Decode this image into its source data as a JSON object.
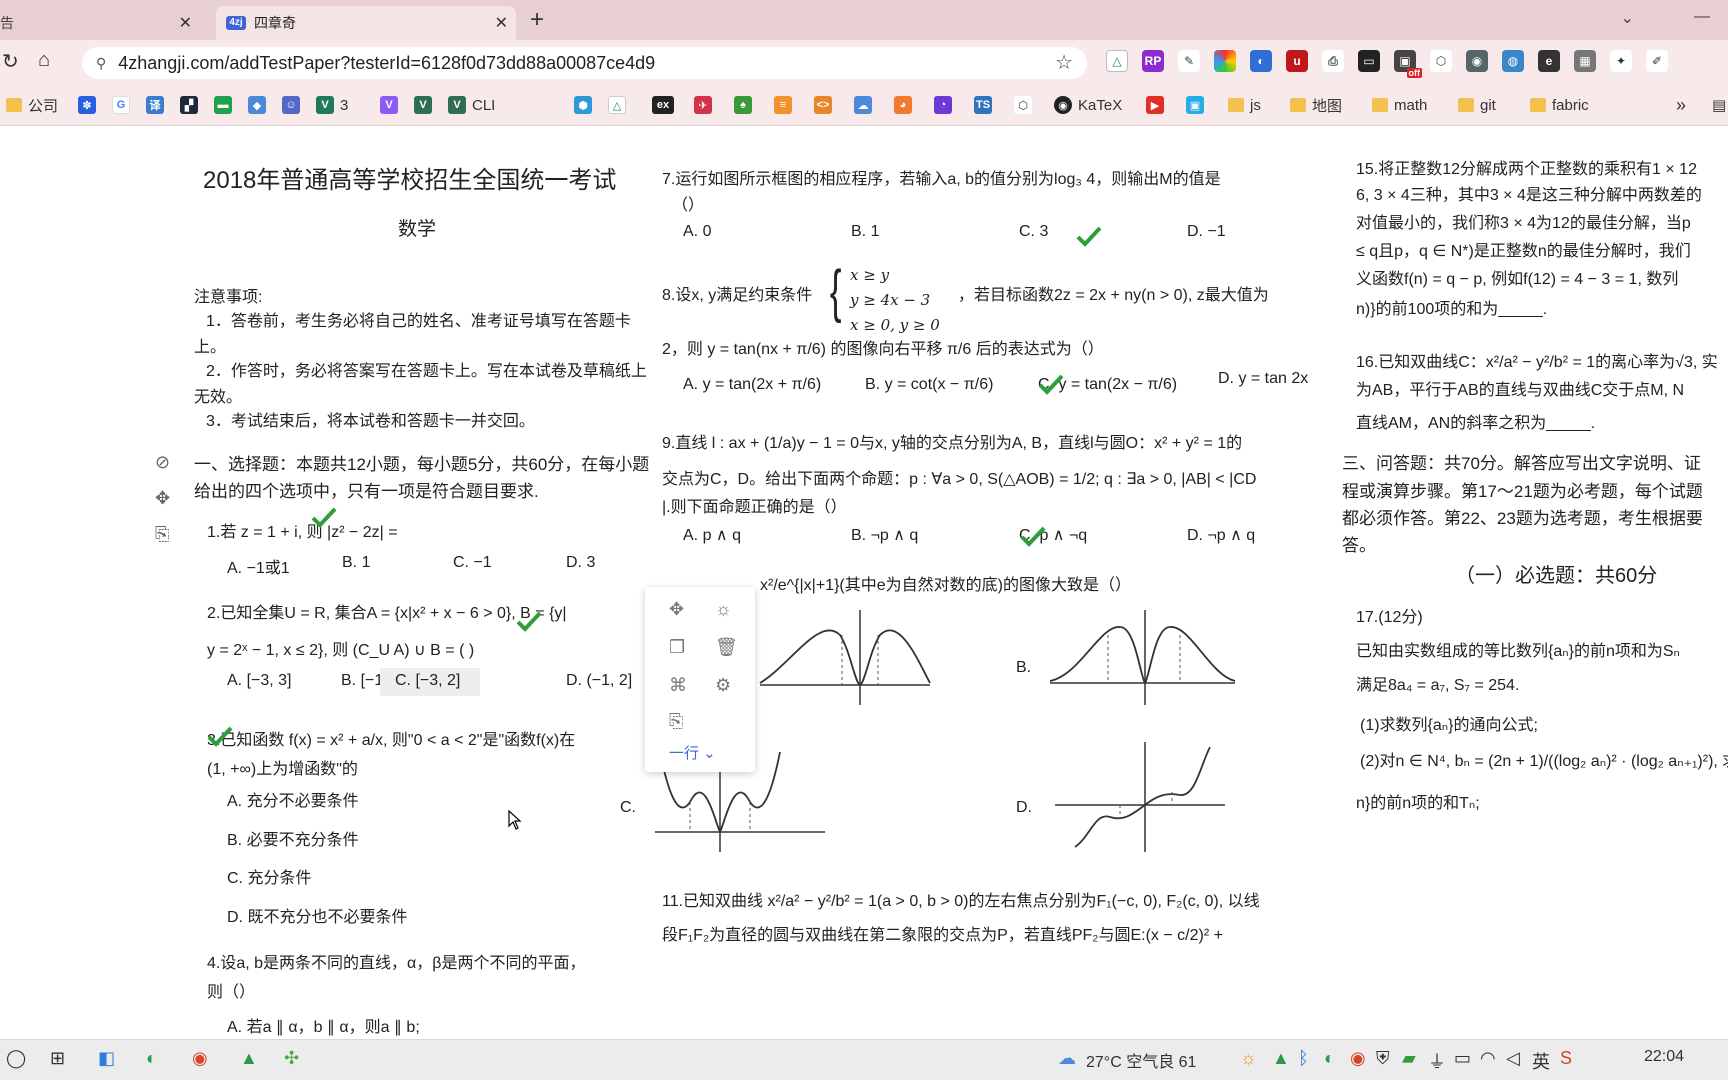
{
  "browser": {
    "tabs": [
      {
        "label": "告",
        "active": false
      },
      {
        "label": "四章奇",
        "active": true,
        "favicon": "4zj"
      }
    ],
    "url": "4zhangji.com/addTestPaper?testerId=6128f0d73dd88a00087ce4d9",
    "bookmarks": [
      "公司",
      "3",
      "CLI",
      "ex",
      "KaTeX",
      "js",
      "地图",
      "math",
      "git",
      "fabric"
    ],
    "ext_badge": "off",
    "ext_rp": "RP"
  },
  "paper": {
    "title": "2018年普通高等学校招生全国统一考试",
    "subject": "数学",
    "notice_title": "注意事项:",
    "notices": [
      "1．答卷前，考生务必将自己的姓名、准考证号填写在答题卡上。",
      "2．作答时，务必将答案写在答题卡上。写在本试卷及草稿纸上无效。",
      "3．考试结束后，将本试卷和答题卡一并交回。"
    ],
    "section1": "一、选择题：本题共12小题，每小题5分，共60分，在每小题给出的四个选项中，只有一项是符合题目要求.",
    "q1": "1.若 z = 1 + i, 则 |z² − 2z| =",
    "q1_opts": [
      "A. −1或1",
      "B. 1",
      "C. −1",
      "D. 3"
    ],
    "q2": "2.已知全集U = R, 集合A = {x|x² + x − 6 > 0}, B = {y|",
    "q2b": "y = 2ˣ − 1, x ≤ 2}, 则 (C_U A) ∪ B = (   )",
    "q2_opts": [
      "A. [−3, 3]",
      "B. [−1, 2]",
      "C. [−3, 2]",
      "D. (−1, 2]"
    ],
    "q3": "3.已知函数 f(x) = x² + a/x, 则\"0 < a < 2\"是\"函数f(x)在",
    "q3b": "(1, +∞)上为增函数\"的",
    "q3_opts": [
      "A. 充分不必要条件",
      "B. 必要不充分条件",
      "C. 充分条件",
      "D. 既不充分也不必要条件"
    ],
    "q4": "4.设a, b是两条不同的直线，α，β是两个不同的平面，",
    "q4b": "则（）",
    "q4_a": "A. 若a ∥ α，b ∥ α，则a ∥ b;",
    "q7": "7.运行如图所示框图的相应程序，若输入a, b的值分别为log₃ 4，则输出M的值是",
    "q7b": "（）",
    "q7_opts": [
      "A. 0",
      "B. 1",
      "C. 3",
      "D. −1"
    ],
    "q8": "8.设x, y满足约束条件",
    "q8_sys": [
      "x  ≥ y",
      "y  ≥ 4x − 3",
      "x  ≥ 0, y ≥ 0"
    ],
    "q8c": "，若目标函数2z = 2x + ny(n > 0), z最大值为",
    "q8d": "2，则 y = tan(nx + π/6) 的图像向右平移 π/6 后的表达式为（）",
    "q8_opts": [
      "A. y = tan(2x + π/6)",
      "B. y = cot(x − π/6)",
      "C. y = tan(2x − π/6)",
      "D. y = tan 2x"
    ],
    "q9": "9.直线 l : ax + (1/a)y − 1 = 0与x, y轴的交点分别为A, B，直线l与圆O：x² + y² = 1的",
    "q9b": "交点为C，D。给出下面两个命题：p : ∀a > 0, S(△AOB) = 1/2; q : ∃a > 0, |AB| < |CD",
    "q9c": "|.则下面命题正确的是（）",
    "q9_opts": [
      "A. p ∧ q",
      "B. ¬p ∧ q",
      "C. p ∧ ¬q",
      "D. ¬p ∧ q"
    ],
    "q10": "x²/e^{|x|+1}(其中e为自然对数的底)的图像大致是（）",
    "graph_labels": [
      "A.",
      "B.",
      "C.",
      "D."
    ],
    "q11": "11.已知双曲线 x²/a² − y²/b² = 1(a > 0, b > 0)的左右焦点分别为F₁(−c, 0), F₂(c, 0), 以线",
    "q11b": "段F₁F₂为直径的圆与双曲线在第二象限的交点为P，若直线PF₂与圆E:(x − c/2)² +",
    "q15": "15.将正整数12分解成两个正整数的乘积有1 × 12",
    "q15b": "6, 3 × 4三种，其中3 × 4是这三种分解中两数差的",
    "q15c": "对值最小的，我们称3 × 4为12的最佳分解，当p",
    "q15d": "≤ q且p，q ∈ N*)是正整数n的最佳分解时，我们",
    "q15e": "义函数f(n) = q − p, 例如f(12) = 4 − 3 = 1, 数列",
    "q15f": "n)}的前100项的和为_____.",
    "q16": "16.已知双曲线C：x²/a² − y²/b² = 1的离心率为√3, 实",
    "q16b": "为AB，平行于AB的直线与双曲线C交于点M, N",
    "q16c": "直线AM，AN的斜率之积为_____.",
    "section3": "三、问答题：共70分。解答应写出文字说明、证",
    "section3b": "程或演算步骤。第17～21题为必考题，每个试题",
    "section3c": "都必须作答。第22、23题为选考题，考生根据要",
    "section3d": "答。",
    "must": "（一）必选题：共60分",
    "q17": "17.(12分)",
    "q17a": "已知由实数组成的等比数列{aₙ}的前n项和为Sₙ",
    "q17b": "满足8a₄ = a₇, S₇ = 254.",
    "q17c": "(1)求数列{aₙ}的通向公式;",
    "q17d": "(2)对n ∈ N⁴, bₙ = (2n + 1)/((log₂ aₙ)² · (log₂ aₙ₊₁)²), 求数",
    "q17e": "n}的前n项的和Tₙ;"
  },
  "popup": {
    "row_label": "一行"
  },
  "taskbar": {
    "weather": "27°C 空气良 61",
    "time": "22:04"
  },
  "colors": {
    "check": "#2e9e3a",
    "tab_bg": "#e7cfd2",
    "accent": "#3a6ad8"
  }
}
